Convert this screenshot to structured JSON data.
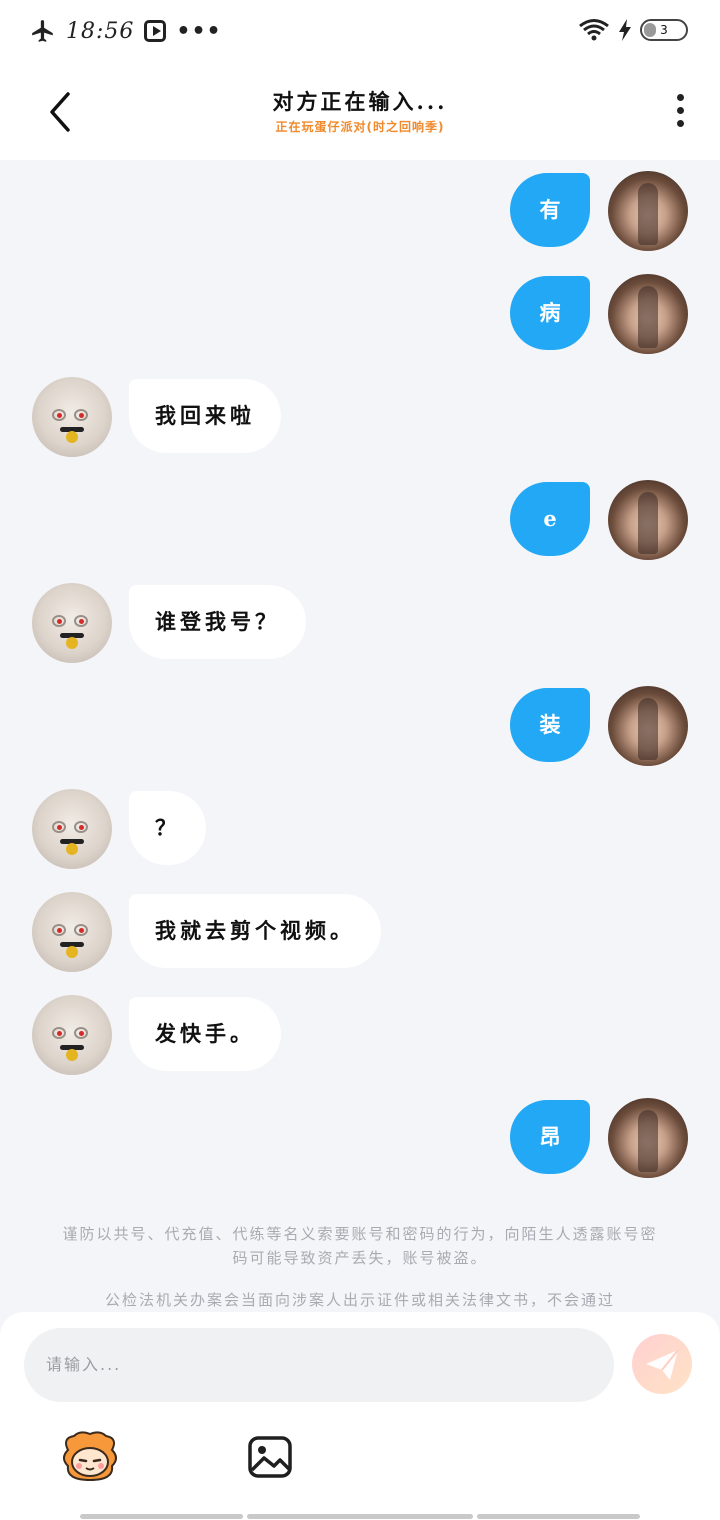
{
  "status_bar": {
    "time": "18:56",
    "dots": "•••",
    "battery": "3",
    "battery_level": 0.3,
    "icons": [
      "airplane-icon",
      "video-play-icon",
      "more-dots-icon",
      "wifi-icon",
      "charging-bolt-icon",
      "battery-icon"
    ]
  },
  "header": {
    "title": "对方正在输入...",
    "subtitle": "正在玩蛋仔派对(时之回响季)",
    "subtitle_color": "#f08a2c"
  },
  "messages": [
    {
      "side": "me",
      "text": "有"
    },
    {
      "side": "me",
      "text": "病"
    },
    {
      "side": "other",
      "text": "我回来啦"
    },
    {
      "side": "me",
      "text": "e"
    },
    {
      "side": "other",
      "text": "谁登我号？"
    },
    {
      "side": "me",
      "text": "装"
    },
    {
      "side": "other",
      "text": "？"
    },
    {
      "side": "other",
      "text": "我就去剪个视频。"
    },
    {
      "side": "other",
      "text": "发快手。"
    },
    {
      "side": "me",
      "text": "昂"
    }
  ],
  "notice": {
    "line1": "谨防以共号、代充值、代练等名义索要账号和密码的行为，向陌生人透露账号密码可能导致资产丢失，账号被盗。",
    "line2": "公检法机关办案会当面向涉案人出示证件或相关法律文书，不会通过"
  },
  "input": {
    "placeholder": "请输入..."
  },
  "colors": {
    "my_bubble": "#22a8f4",
    "other_bubble": "#ffffff",
    "background": "#f4f5f8",
    "send_button": "#ffd6cc"
  }
}
